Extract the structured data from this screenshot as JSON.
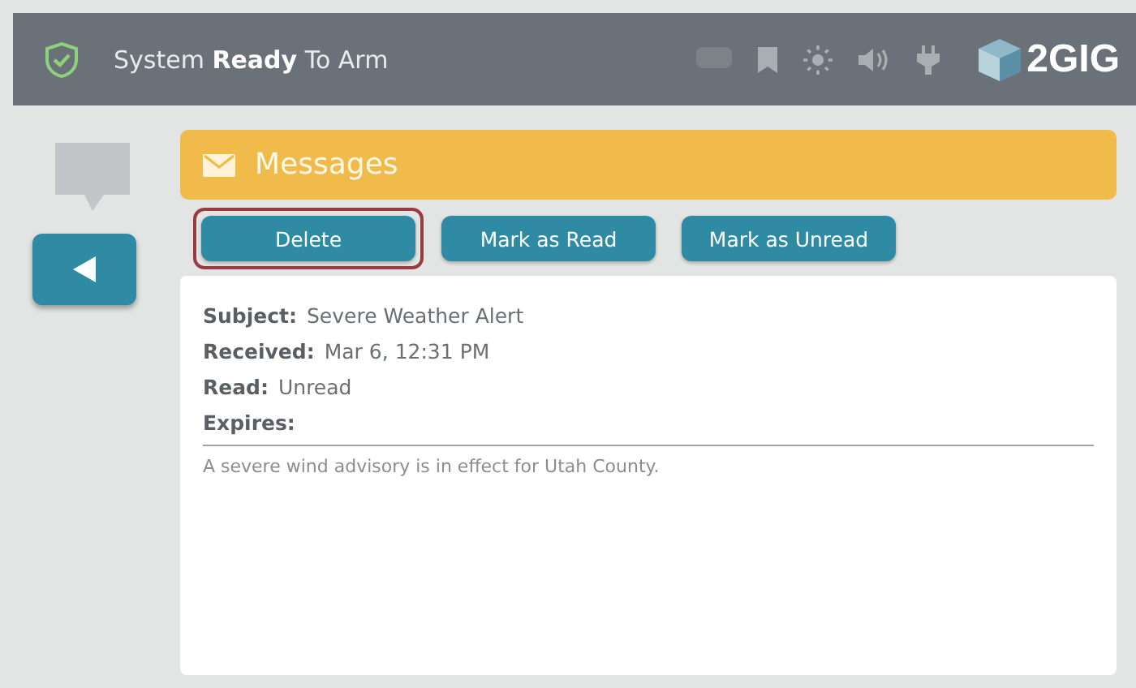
{
  "status_bar": {
    "text": "System **Ready** To Arm",
    "brand": "2GIG"
  },
  "header": {
    "title": "Messages"
  },
  "buttons": [
    {
      "label": "Delete",
      "selected": true
    },
    {
      "label": "Mark as Read",
      "selected": false
    },
    {
      "label": "Mark as Unread",
      "selected": false
    }
  ],
  "message": {
    "fields": [
      {
        "label": "Subject:",
        "value": "Severe Weather Alert"
      },
      {
        "label": "Received:",
        "value": "Mar 6, 12:31 PM"
      },
      {
        "label": "Read:",
        "value": "Unread"
      },
      {
        "label": "Expires:"
      }
    ],
    "body": "A severe wind advisory is in effect for Utah County."
  }
}
